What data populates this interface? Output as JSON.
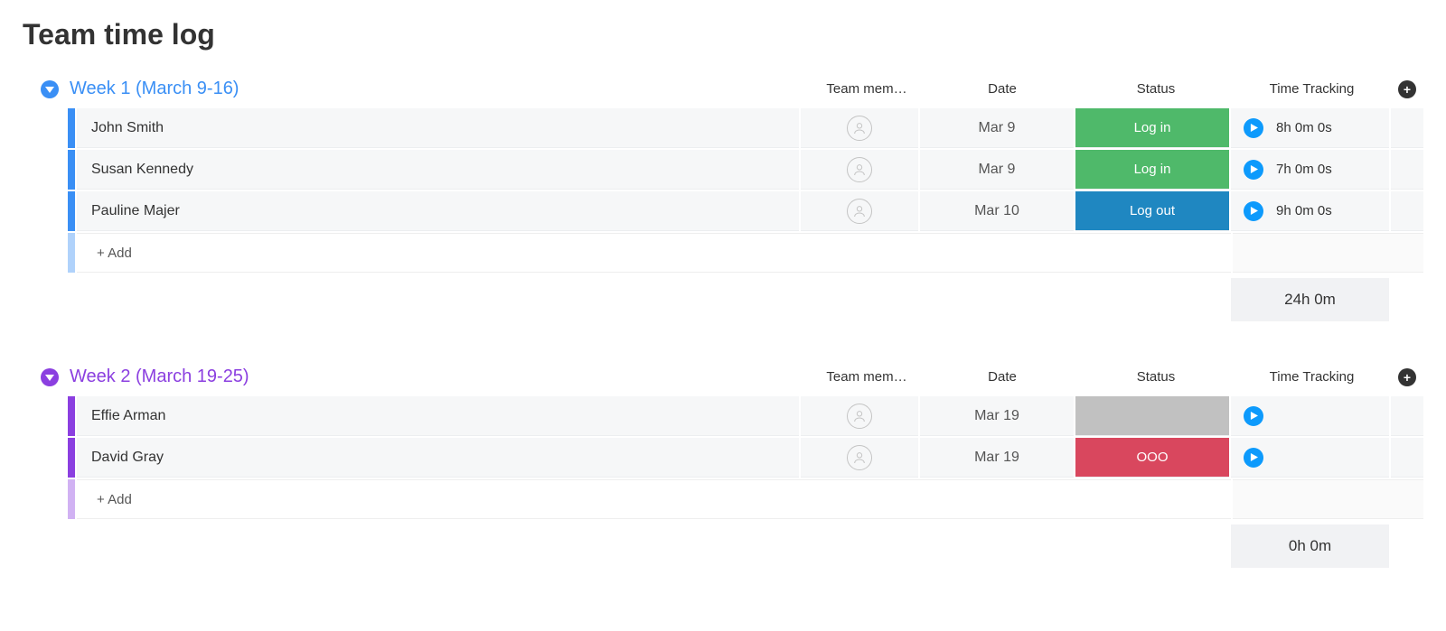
{
  "page_title": "Team time log",
  "columns": {
    "member": "Team mem…",
    "date": "Date",
    "status": "Status",
    "tracking": "Time Tracking"
  },
  "add_label": "+ Add",
  "status_colors": {
    "log_in": "#4fb96a",
    "log_out": "#1f87c1",
    "ooo": "#d9475e",
    "blank": "#c1c1c1"
  },
  "groups": [
    {
      "title": "Week 1 (March 9-16)",
      "accent": "#3a8ff5",
      "tasks": [
        {
          "name": "John Smith",
          "date": "Mar 9",
          "status_key": "log_in",
          "status_text": "Log in",
          "time": "8h 0m 0s"
        },
        {
          "name": "Susan Kennedy",
          "date": "Mar 9",
          "status_key": "log_in",
          "status_text": "Log in",
          "time": "7h 0m 0s"
        },
        {
          "name": "Pauline Majer",
          "date": "Mar 10",
          "status_key": "log_out",
          "status_text": "Log out",
          "time": "9h 0m 0s"
        }
      ],
      "total": "24h 0m"
    },
    {
      "title": "Week 2 (March 19-25)",
      "accent": "#8b3fe0",
      "tasks": [
        {
          "name": "Effie Arman",
          "date": "Mar 19",
          "status_key": "blank",
          "status_text": "",
          "time": ""
        },
        {
          "name": "David Gray",
          "date": "Mar 19",
          "status_key": "ooo",
          "status_text": "OOO",
          "time": ""
        }
      ],
      "total": "0h 0m"
    }
  ]
}
